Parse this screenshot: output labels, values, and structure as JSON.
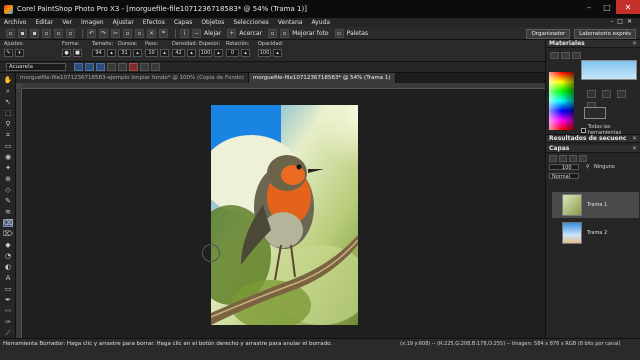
{
  "window": {
    "title": "Corel PaintShop Photo Pro X3 - [morguefile-file1071236718583* @  54% (Trama 1)]",
    "controls": [
      "–",
      "□",
      "✕"
    ]
  },
  "menu": {
    "items": [
      "Archivo",
      "Editar",
      "Ver",
      "Imagen",
      "Ajustar",
      "Efectos",
      "Capas",
      "Objetos",
      "Selecciones",
      "Ventana",
      "Ayuda"
    ],
    "doc_controls": [
      "–",
      "□",
      "✕"
    ]
  },
  "toolbar": {
    "alejar": "Alejar",
    "acercar": "Acercar",
    "mejorar_foto": "Mejorar foto",
    "paletas": "Paletas",
    "organizador": "Organizador",
    "laboratorio": "Laboratorio exprés"
  },
  "options": {
    "ajustes": "Ajustes:",
    "forma": "Forma:",
    "tamano": "Tamaño:",
    "tamano_val": "94",
    "dureza": "Dureza:",
    "dureza_val": "31",
    "paso": "Paso:",
    "paso_val": "10",
    "densidad": "Densidad:",
    "densidad_val": "42",
    "espesor": "Espesor:",
    "espesor_val": "100",
    "rotacion": "Rotación:",
    "rotacion_val": "0",
    "opacidad": "Opacidad:",
    "opacidad_val": "100",
    "preset": "Acuarela"
  },
  "tabs": [
    {
      "label": "morguefile-file1071236718583-ejemplo limpiar fondo* @ 100% (Copia de Fondo)",
      "active": false
    },
    {
      "label": "morguefile-file1071236718583* @  54% (Trama 1)",
      "active": true
    }
  ],
  "panels": {
    "materiales": "Materiales",
    "todas_herramientas": "Todas las herramientas",
    "resultados": "Resultados de secuenc",
    "capas": "Capas",
    "capas_opacity": "100",
    "capas_mode": "Normal",
    "capas_blend": "Ninguno",
    "layers": [
      {
        "name": "Trama 1",
        "selected": true
      },
      {
        "name": "Trama 2",
        "selected": false
      }
    ]
  },
  "status": {
    "hint": "Herramienta Borrador: Haga clic y arrastre para borrar. Haga clic en el botón derecho y arrastre para anular el borrado.",
    "coords": "(x:19 y:608) -- (R:225,G:208,B:178,O:255) -- Imagen:  584 x 876 x RGB (8 bits por canal)"
  },
  "colors": {
    "accent": "#4a5a78",
    "close": "#c4312b"
  }
}
